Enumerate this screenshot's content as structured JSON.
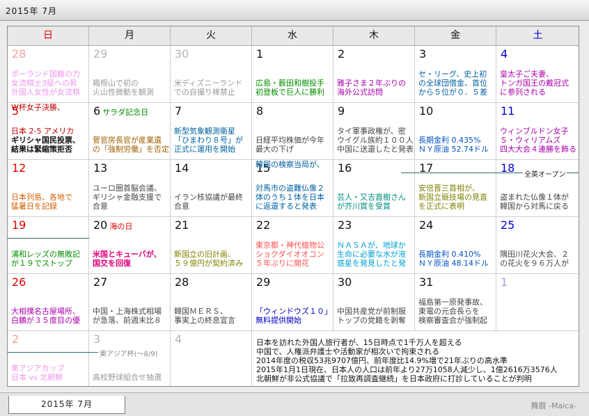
{
  "window": {
    "title": "2015年 7月"
  },
  "tab": {
    "label": "2015年 7月"
  },
  "app": {
    "name": "舞暦 -Maica-"
  },
  "colors": {
    "sunday": "#e00000",
    "saturday": "#0000d0",
    "weekday": "#111111",
    "other_month": "#b5b5b5"
  },
  "weekdays": [
    "日",
    "月",
    "火",
    "水",
    "木",
    "金",
    "土"
  ],
  "weeks": [
    [
      {
        "day": "28",
        "other": true,
        "events": [
          {
            "t": "ポーランド国籍の力",
            "c": "#e040e0",
            "l": 2
          },
          {
            "t": "女流棋士3級への昇",
            "c": "#e040e0",
            "l": 3
          },
          {
            "t": "外国人女性が女流棋",
            "c": "#e040e0",
            "l": 4
          }
        ]
      },
      {
        "day": "29",
        "other": true,
        "events": [
          {
            "t": "箱根山で初の",
            "c": "#444",
            "l": 3
          },
          {
            "t": "火山性微動を観測",
            "c": "#444",
            "l": 4
          }
        ]
      },
      {
        "day": "30",
        "other": true,
        "events": [
          {
            "t": "米ディズニーランド",
            "c": "#444",
            "l": 3
          },
          {
            "t": "での自撮り棒禁止",
            "c": "#444",
            "l": 4
          }
        ]
      },
      {
        "day": "1",
        "events": [
          {
            "t": "広島・薮田和樹投手",
            "c": "#008c00",
            "l": 3
          },
          {
            "t": "初登板で巨人に勝利",
            "c": "#008c00",
            "l": 4
          }
        ]
      },
      {
        "day": "2",
        "events": [
          {
            "t": "雅子さま２年ぶりの",
            "c": "#aa00aa",
            "l": 3
          },
          {
            "t": "海外公式訪問",
            "c": "#aa00aa",
            "l": 4
          }
        ]
      },
      {
        "day": "3",
        "events": [
          {
            "t": "セ・リーグ、史上初",
            "c": "#0060a0",
            "l": 2
          },
          {
            "t": "の全球団借金、首位",
            "c": "#0060a0",
            "l": 3
          },
          {
            "t": "から５位が０．５差",
            "c": "#0060a0",
            "l": 4
          }
        ]
      },
      {
        "day": "4",
        "events": [
          {
            "t": "皇太子ご夫妻、",
            "c": "#aa00aa",
            "l": 2
          },
          {
            "t": "トンガ国王の戴冠式",
            "c": "#aa00aa",
            "l": 3
          },
          {
            "t": "に参列される",
            "c": "#aa00aa",
            "l": 4
          }
        ]
      }
    ],
    [
      {
        "day": "5",
        "events": [
          {
            "t": "W杯女子決勝、",
            "c": "#c00000",
            "l": 1
          },
          {
            "t": "日本 2-5 アメリカ",
            "c": "#c00000",
            "l": 2
          },
          {
            "t": "ギリシャ国民投票、",
            "c": "#111",
            "l": 3,
            "b": true
          },
          {
            "t": "結果は緊縮策拒否",
            "c": "#111",
            "l": 4,
            "b": true
          }
        ]
      },
      {
        "day": "6",
        "holiday": "サラダ記念日",
        "hc": "#008c00",
        "events": [
          {
            "t": "菅官房長官が産業遺",
            "c": "#a06000",
            "l": 3
          },
          {
            "t": "の「強制労働」を否定",
            "c": "#a06000",
            "l": 4
          }
        ]
      },
      {
        "day": "7",
        "events": [
          {
            "t": "新型気象観測衛星",
            "c": "#0060a0",
            "l": 2
          },
          {
            "t": "「ひまわり８号」が",
            "c": "#0060a0",
            "l": 3
          },
          {
            "t": "正式に運用を開始",
            "c": "#0060a0",
            "l": 4
          }
        ]
      },
      {
        "day": "8",
        "events": [
          {
            "t": "日経平均株価が今年",
            "c": "#444",
            "l": 3
          },
          {
            "t": "最大の下げ",
            "c": "#444",
            "l": 4
          }
        ]
      },
      {
        "day": "9",
        "events": [
          {
            "t": "タイ軍事政権が、密",
            "c": "#444",
            "l": 2
          },
          {
            "t": "ウイグル族約１００人",
            "c": "#444",
            "l": 3
          },
          {
            "t": "中国に送還したと発表",
            "c": "#444",
            "l": 4
          }
        ]
      },
      {
        "day": "10",
        "events": [
          {
            "t": "長期金利 0.435%",
            "c": "#0050c0",
            "l": 3
          },
          {
            "t": "ＮＹ原油 52.74ドル",
            "c": "#0050c0",
            "l": 4
          }
        ]
      },
      {
        "day": "11",
        "events": [
          {
            "t": "ウィンブルドン女子",
            "c": "#aa00aa",
            "l": 2
          },
          {
            "t": "Ｓ・ウィリアムズ",
            "c": "#aa00aa",
            "l": 3
          },
          {
            "t": "四大大会４連勝を飾る",
            "c": "#aa00aa",
            "l": 4
          }
        ]
      }
    ],
    [
      {
        "day": "12",
        "events": [
          {
            "t": "日本列島、各地で",
            "c": "#d06000",
            "l": 3
          },
          {
            "t": "猛暑日を記録",
            "c": "#d06000",
            "l": 4
          }
        ]
      },
      {
        "day": "13",
        "events": [
          {
            "t": "ユーロ圏首脳会議、",
            "c": "#444",
            "l": 2
          },
          {
            "t": "ギリシャ金融支援で",
            "c": "#444",
            "l": 3
          },
          {
            "t": "合意",
            "c": "#444",
            "l": 4
          }
        ]
      },
      {
        "day": "14",
        "events": [
          {
            "t": "イラン核協議が最終",
            "c": "#444",
            "l": 3
          },
          {
            "t": "合意",
            "c": "#444",
            "l": 4
          }
        ]
      },
      {
        "day": "15",
        "events": [
          {
            "t": "韓国の検察当局が、",
            "c": "#0060a0",
            "l": 1
          },
          {
            "t": "対馬市の盗難仏像２",
            "c": "#0060a0",
            "l": 2
          },
          {
            "t": "体のうち１体を日本",
            "c": "#0060a0",
            "l": 3
          },
          {
            "t": "に返還すると発表",
            "c": "#0060a0",
            "l": 4
          }
        ]
      },
      {
        "day": "16",
        "events": [
          {
            "t": "芸人・又吉直樹さん",
            "c": "#008c80",
            "l": 3
          },
          {
            "t": "が芥川賞を受賞",
            "c": "#008c80",
            "l": 4
          }
        ]
      },
      {
        "day": "17",
        "events": [
          {
            "t": "安倍晋三首相が、",
            "c": "#808000",
            "l": 2
          },
          {
            "t": "新国立競技場の見直",
            "c": "#808000",
            "l": 3
          },
          {
            "t": "を正式に表明",
            "c": "#808000",
            "l": 4
          }
        ]
      },
      {
        "day": "18",
        "events": [
          {
            "t": "盗まれた仏像１体が",
            "c": "#444",
            "l": 3
          },
          {
            "t": "韓国から対馬に戻る",
            "c": "#444",
            "l": 4
          }
        ]
      }
    ],
    [
      {
        "day": "19",
        "events": [
          {
            "t": "浦和レッズの無敗記",
            "c": "#008c00",
            "l": 3
          },
          {
            "t": "が１９でストップ",
            "c": "#008c00",
            "l": 4
          }
        ]
      },
      {
        "day": "20",
        "holiday": "海の日",
        "hc": "#e00000",
        "events": [
          {
            "t": "米国とキューバが、",
            "c": "#e0007a",
            "l": 3,
            "b": true
          },
          {
            "t": "国交を回復",
            "c": "#e0007a",
            "l": 4,
            "b": true
          }
        ]
      },
      {
        "day": "21",
        "events": [
          {
            "t": "新国立の旧計画、",
            "c": "#808000",
            "l": 3
          },
          {
            "t": "５９億円が契約済み",
            "c": "#808000",
            "l": 4
          }
        ]
      },
      {
        "day": "22",
        "events": [
          {
            "t": "東京都・神代植物公",
            "c": "#ff5050",
            "l": 2
          },
          {
            "t": "ショクダイオオコン",
            "c": "#ff5050",
            "l": 3
          },
          {
            "t": "５年ぶりに開花",
            "c": "#ff5050",
            "l": 4
          }
        ]
      },
      {
        "day": "23",
        "events": [
          {
            "t": "ＮＡＳＡが、地球か",
            "c": "#00a0d0",
            "l": 2
          },
          {
            "t": "生命に必要な水が液",
            "c": "#00a0d0",
            "l": 3
          },
          {
            "t": "惑星を発見したと発",
            "c": "#00a0d0",
            "l": 4
          }
        ]
      },
      {
        "day": "24",
        "events": [
          {
            "t": "長期金利 0.410%",
            "c": "#0050c0",
            "l": 3
          },
          {
            "t": "ＮＹ原油 48.14ドル",
            "c": "#0050c0",
            "l": 4
          }
        ]
      },
      {
        "day": "25",
        "events": [
          {
            "t": "隅田川花火大会、２",
            "c": "#444",
            "l": 3
          },
          {
            "t": "の花火を９６万人が",
            "c": "#444",
            "l": 4
          }
        ]
      }
    ],
    [
      {
        "day": "26",
        "events": [
          {
            "t": "大相撲名古屋場所、",
            "c": "#aa00aa",
            "l": 3
          },
          {
            "t": "白鵬が３５度目の優",
            "c": "#aa00aa",
            "l": 4
          }
        ]
      },
      {
        "day": "27",
        "events": [
          {
            "t": "中国・上海株式相場",
            "c": "#444",
            "l": 3
          },
          {
            "t": "が急落、前週末比８",
            "c": "#444",
            "l": 4
          }
        ]
      },
      {
        "day": "28",
        "events": [
          {
            "t": "韓国ＭＥＲＳ、",
            "c": "#444",
            "l": 3
          },
          {
            "t": "事実上の終息宣言",
            "c": "#444",
            "l": 4
          }
        ]
      },
      {
        "day": "29",
        "events": [
          {
            "t": "「ウィンドウズ１０」",
            "c": "#0000c0",
            "l": 3
          },
          {
            "t": "無料提供開始",
            "c": "#0000c0",
            "l": 4
          }
        ]
      },
      {
        "day": "30",
        "events": [
          {
            "t": "中国共産党が前制服",
            "c": "#444",
            "l": 3
          },
          {
            "t": "トップの党籍を剥奪",
            "c": "#444",
            "l": 4
          }
        ]
      },
      {
        "day": "31",
        "events": [
          {
            "t": "福島第一原発事故、",
            "c": "#444",
            "l": 2
          },
          {
            "t": "東電の元会長らを",
            "c": "#444",
            "l": 3
          },
          {
            "t": "検察審査会が強制起",
            "c": "#444",
            "l": 4
          }
        ]
      },
      {
        "day": "1",
        "other": true,
        "events": []
      }
    ],
    [
      {
        "day": "2",
        "other": true,
        "events": [
          {
            "t": "東アジアカップ",
            "c": "#e040e0",
            "l": 3
          },
          {
            "t": "日本 vs 北朝鮮",
            "c": "#e040e0",
            "l": 4
          }
        ]
      },
      {
        "day": "3",
        "other": true,
        "events": [
          {
            "t": "高校野球組合せ抽選",
            "c": "#444",
            "l": 4
          }
        ]
      },
      {
        "day": "4",
        "other": true,
        "events": []
      }
    ]
  ],
  "bands": {
    "zenei_open": "全英オープン",
    "east_asia_cup": "東アジア杯(～8/9)"
  },
  "news": [
    "日本を訪れた外国人旅行者が、15日時点で1千万人を超える",
    "中国で、人権派弁護士や活動家が相次いで拘束される",
    "2014年度の税収53兆9707億円、前年度比14.9%増で21年ぶりの高水準",
    "2015年1月1日現在、日本人の人口は前年より27万1058人減少し、1億2616万3576人",
    "北朝鮮が非公式協議で「拉致再調査継続」を日本政府に打診していることが判明"
  ]
}
